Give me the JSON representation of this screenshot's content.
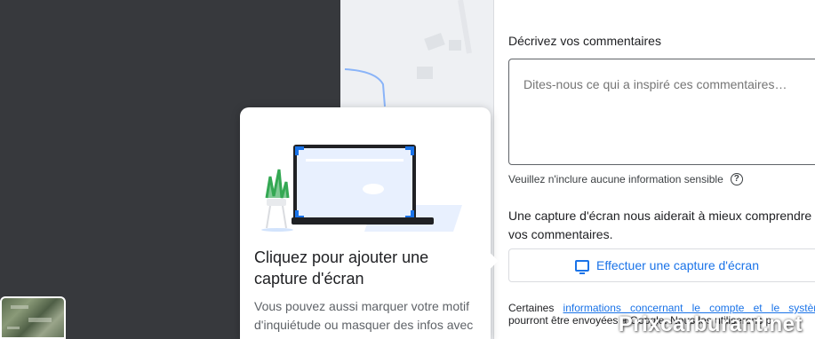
{
  "feedback": {
    "description_label": "Décrivez vos commentaires",
    "textarea_placeholder": "Dites-nous ce qui a inspiré ces commentaires…",
    "sensitive_hint": "Veuillez n'inclure aucune information sensible",
    "help_icon_glyph": "?",
    "screenshot_prompt": "Une capture d'écran nous aiderait à mieux comprendre vos commentaires.",
    "screenshot_button": "Effectuer une capture d'écran",
    "legal_prefix": "Certaines ",
    "legal_link": "informations concernant le compte et le système",
    "legal_suffix": " pourront être envoyées à Google. Nous les utiliserons p"
  },
  "tip": {
    "title": "Cliquez pour ajouter une capture d'écran",
    "body": "Vous pouvez aussi marquer votre motif d'inquiétude ou masquer des infos avec l'outil d'édition"
  },
  "watermark": "Prixcarburant.net",
  "colors": {
    "accent": "#1a73e8",
    "dark_background": "#37393d",
    "laptop_frame": "#202124",
    "corner_marks": "#1a73e8"
  },
  "icons": {
    "help": "question-circle-icon",
    "screenshot": "monitor-icon"
  }
}
